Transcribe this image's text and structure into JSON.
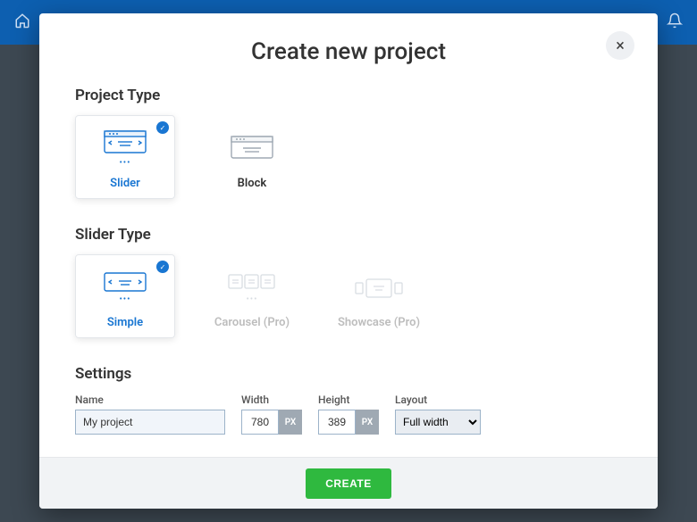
{
  "modal": {
    "title": "Create new project",
    "close_label": "×",
    "sections": {
      "project_type_heading": "Project Type",
      "slider_type_heading": "Slider Type",
      "settings_heading": "Settings"
    },
    "project_types": [
      {
        "key": "slider",
        "label": "Slider",
        "selected": true
      },
      {
        "key": "block",
        "label": "Block",
        "selected": false
      }
    ],
    "slider_types": [
      {
        "key": "simple",
        "label": "Simple",
        "selected": true,
        "disabled": false
      },
      {
        "key": "carousel",
        "label": "Carousel (Pro)",
        "selected": false,
        "disabled": true
      },
      {
        "key": "showcase",
        "label": "Showcase (Pro)",
        "selected": false,
        "disabled": true
      }
    ],
    "settings": {
      "name_label": "Name",
      "name_value": "My project",
      "width_label": "Width",
      "width_value": "780",
      "width_unit": "PX",
      "height_label": "Height",
      "height_value": "389",
      "height_unit": "PX",
      "layout_label": "Layout",
      "layout_value": "Full width"
    },
    "create_button": "CREATE"
  }
}
